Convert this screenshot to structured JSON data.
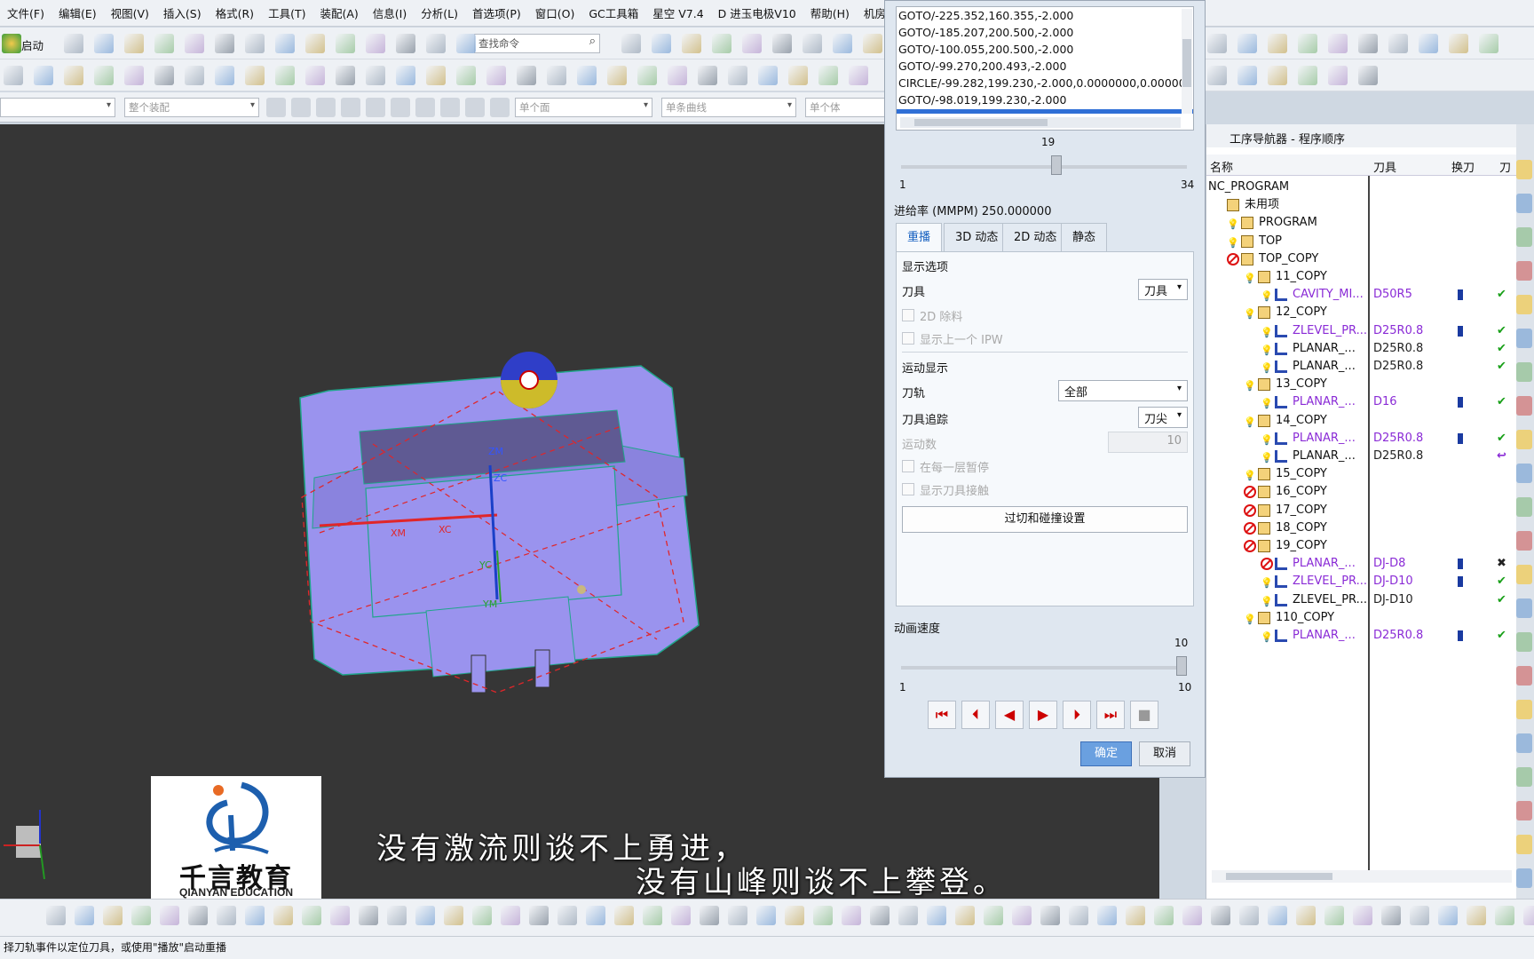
{
  "menu": [
    "文件(F)",
    "编辑(E)",
    "视图(V)",
    "插入(S)",
    "格式(R)",
    "工具(T)",
    "装配(A)",
    "信息(I)",
    "分析(L)",
    "首选项(P)",
    "窗口(O)",
    "GC工具箱",
    "星空 V7.4",
    "D 进玉电极V10",
    "帮助(H)",
    "机房软件"
  ],
  "toolbar": {
    "start_label": "启动",
    "search_placeholder": "查找命令",
    "filter1": "整个装配",
    "filter2": "单个面",
    "filter3": "单条曲线",
    "filter4": "单个体"
  },
  "viewport": {
    "axis_zm": "ZM",
    "axis_zc": "ZC",
    "axis_xm": "XM",
    "axis_xc": "XC",
    "axis_yc": "YC",
    "axis_ym": "YM"
  },
  "logo": {
    "cn": "千言教育",
    "en": "QIANYAN EDUCATION"
  },
  "subtitle": {
    "line1": "没有激流则谈不上勇进，",
    "line2": "没有山峰则谈不上攀登。"
  },
  "dialog": {
    "code_lines": [
      "GOTO/-225.352,160.355,-2.000",
      "GOTO/-185.207,200.500,-2.000",
      "GOTO/-100.055,200.500,-2.000",
      "GOTO/-99.270,200.493,-2.000",
      "CIRCLE/-99.282,199.230,-2.000,0.0000000,0.00000",
      "GOTO/-98.019,199.230,-2.000"
    ],
    "step_value": "19",
    "step_min": "1",
    "step_max": "34",
    "step_fraction": 0.545,
    "feed": "进给率 (MMPM) 250.000000",
    "tabs": [
      "重播",
      "3D 动态",
      "2D 动态",
      "静态"
    ],
    "display_options": "显示选项",
    "tool_label": "刀具",
    "tool_value": "刀具",
    "cb_2d": "2D 除料",
    "cb_ipw": "显示上一个 IPW",
    "motion_display": "运动显示",
    "path_label": "刀轨",
    "path_value": "全部",
    "trace_label": "刀具追踪",
    "trace_value": "刀尖",
    "motion_count_label": "运动数",
    "motion_count": "10",
    "cb_pause": "在每一层暂停",
    "cb_contact": "显示刀具接触",
    "gouge_button": "过切和碰撞设置",
    "anim_speed": "动画速度",
    "speed_value": "10",
    "speed_min": "1",
    "speed_max": "10",
    "speed_fraction": 1.0,
    "ok": "确定",
    "cancel": "取消"
  },
  "navigator": {
    "title": "工序导航器 - 程序顺序",
    "columns": [
      "名称",
      "刀具",
      "换刀",
      "刀"
    ],
    "rows": [
      {
        "name": "NC_PROGRAM",
        "tool": "",
        "level": 0,
        "icon": "none",
        "toolchange": false,
        "check": ""
      },
      {
        "name": "未用项",
        "tool": "",
        "level": 1,
        "icon": "folder",
        "toolchange": false,
        "check": ""
      },
      {
        "name": "PROGRAM",
        "tool": "",
        "level": 1,
        "icon": "bulb-folder",
        "toolchange": false,
        "check": ""
      },
      {
        "name": "TOP",
        "tool": "",
        "level": 1,
        "icon": "bulb-folder",
        "toolchange": false,
        "check": ""
      },
      {
        "name": "TOP_COPY",
        "tool": "",
        "level": 1,
        "icon": "noentry-folder",
        "toolchange": false,
        "check": ""
      },
      {
        "name": "11_COPY",
        "tool": "",
        "level": 2,
        "icon": "bulb-folder",
        "toolchange": false,
        "check": ""
      },
      {
        "name": "CAVITY_MI...",
        "tool": "D50R5",
        "level": 3,
        "icon": "bulb-op",
        "toolchange": true,
        "check": "✔",
        "purple": true
      },
      {
        "name": "12_COPY",
        "tool": "",
        "level": 2,
        "icon": "bulb-folder",
        "toolchange": false,
        "check": ""
      },
      {
        "name": "ZLEVEL_PR...",
        "tool": "D25R0.8",
        "level": 3,
        "icon": "bulb-op",
        "toolchange": true,
        "check": "✔",
        "purple": true
      },
      {
        "name": "PLANAR_...",
        "tool": "D25R0.8",
        "level": 3,
        "icon": "bulb-op",
        "toolchange": false,
        "check": "✔"
      },
      {
        "name": "PLANAR_...",
        "tool": "D25R0.8",
        "level": 3,
        "icon": "bulb-op",
        "toolchange": false,
        "check": "✔"
      },
      {
        "name": "13_COPY",
        "tool": "",
        "level": 2,
        "icon": "bulb-folder",
        "toolchange": false,
        "check": ""
      },
      {
        "name": "PLANAR_...",
        "tool": "D16",
        "level": 3,
        "icon": "bulb-op",
        "toolchange": true,
        "check": "✔",
        "purple": true
      },
      {
        "name": "14_COPY",
        "tool": "",
        "level": 2,
        "icon": "bulb-folder",
        "toolchange": false,
        "check": ""
      },
      {
        "name": "PLANAR_...",
        "tool": "D25R0.8",
        "level": 3,
        "icon": "bulb-op",
        "toolchange": true,
        "check": "✔",
        "purple": true
      },
      {
        "name": "PLANAR_...",
        "tool": "D25R0.8",
        "level": 3,
        "icon": "bulb-op",
        "toolchange": false,
        "check": "↩"
      },
      {
        "name": "15_COPY",
        "tool": "",
        "level": 2,
        "icon": "bulb-folder",
        "toolchange": false,
        "check": ""
      },
      {
        "name": "16_COPY",
        "tool": "",
        "level": 2,
        "icon": "noentry-folder",
        "toolchange": false,
        "check": ""
      },
      {
        "name": "17_COPY",
        "tool": "",
        "level": 2,
        "icon": "noentry-folder",
        "toolchange": false,
        "check": ""
      },
      {
        "name": "18_COPY",
        "tool": "",
        "level": 2,
        "icon": "noentry-folder",
        "toolchange": false,
        "check": ""
      },
      {
        "name": "19_COPY",
        "tool": "",
        "level": 2,
        "icon": "noentry-folder",
        "toolchange": false,
        "check": ""
      },
      {
        "name": "PLANAR_...",
        "tool": "DJ-D8",
        "level": 3,
        "icon": "noentry-op",
        "toolchange": true,
        "check": "✖",
        "purple": true
      },
      {
        "name": "ZLEVEL_PR...",
        "tool": "DJ-D10",
        "level": 3,
        "icon": "bulb-op",
        "toolchange": true,
        "check": "✔",
        "purple": true
      },
      {
        "name": "ZLEVEL_PR...",
        "tool": "DJ-D10",
        "level": 3,
        "icon": "bulb-op",
        "toolchange": false,
        "check": "✔"
      },
      {
        "name": "110_COPY",
        "tool": "",
        "level": 2,
        "icon": "bulb-folder",
        "toolchange": false,
        "check": ""
      },
      {
        "name": "PLANAR_...",
        "tool": "D25R0.8",
        "level": 3,
        "icon": "bulb-op",
        "toolchange": true,
        "check": "✔",
        "purple": true
      }
    ]
  },
  "status": "择刀轨事件以定位刀具，或使用\"播放\"启动重播",
  "colors": {
    "part": "#9a93ee",
    "toolpath": "#e0262a",
    "background": "#363636",
    "accent": "#1560c0"
  }
}
